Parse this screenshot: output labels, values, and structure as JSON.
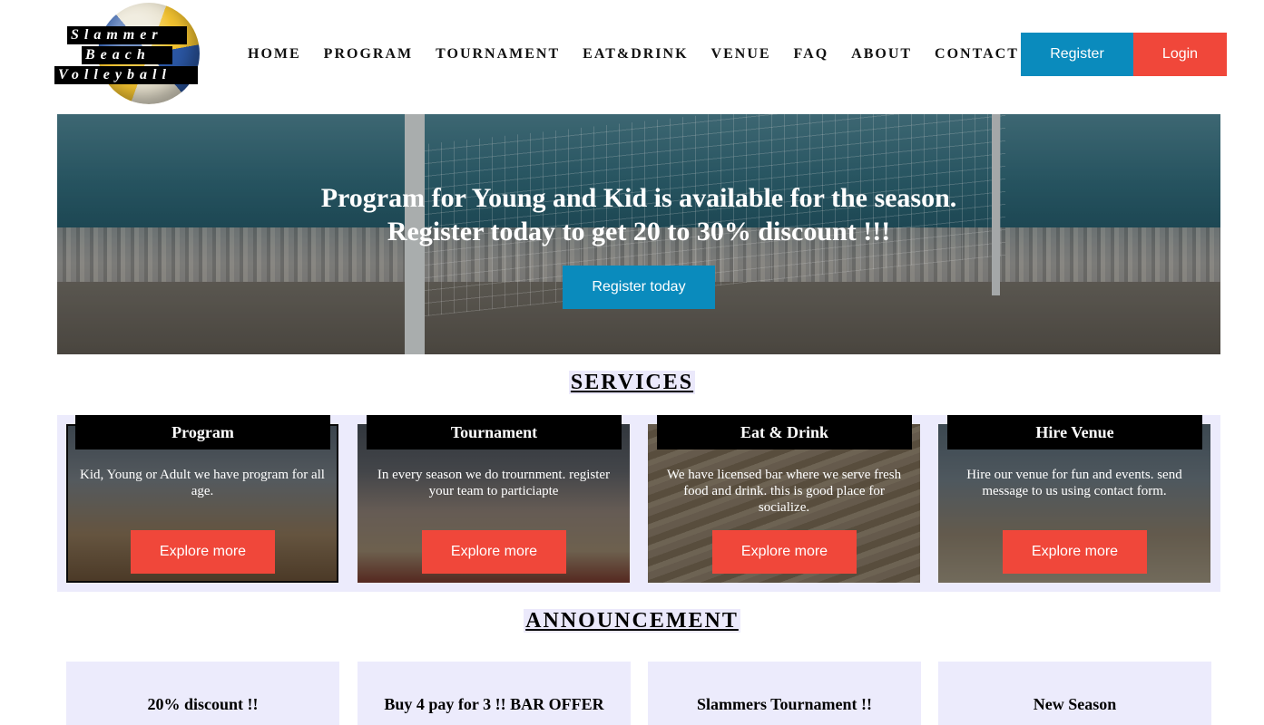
{
  "logo": {
    "line1": "Slammer",
    "line2": "Beach",
    "line3": "Volleyball"
  },
  "nav": {
    "items": [
      "HOME",
      "PROGRAM",
      "TOURNAMENT",
      "EAT&DRINK",
      "VENUE",
      "FAQ",
      "ABOUT",
      "CONTACT"
    ],
    "register_label": "Register",
    "login_label": "Login"
  },
  "hero": {
    "line1": "Program for Young and Kid is available for the season.",
    "line2": "Register today to get 20 to 30% discount !!!",
    "button_label": "Register today"
  },
  "services": {
    "heading": "SERVICES",
    "cards": [
      {
        "title": "Program",
        "text": "Kid, Young or Adult we have program for all age.",
        "button": "Explore more"
      },
      {
        "title": "Tournament",
        "text": "In every season we do trournment. register your team to particiapte",
        "button": "Explore more"
      },
      {
        "title": "Eat & Drink",
        "text": "We have licensed bar where we serve fresh food and drink. this is good place for socialize.",
        "button": "Explore more"
      },
      {
        "title": "Hire Venue",
        "text": "Hire our venue for fun and events. send message to us using contact form.",
        "button": "Explore more"
      }
    ]
  },
  "announcement": {
    "heading": "ANNOUNCEMENT",
    "items": [
      {
        "title": "20% discount !!"
      },
      {
        "title": "Buy 4 pay for 3 !! BAR OFFER"
      },
      {
        "title": "Slammers Tournament !!"
      },
      {
        "title": "New Season"
      }
    ]
  },
  "colors": {
    "primary_blue": "#0a8bbd",
    "accent_red": "#f0473a",
    "panel_lavender": "#ecebfc"
  }
}
